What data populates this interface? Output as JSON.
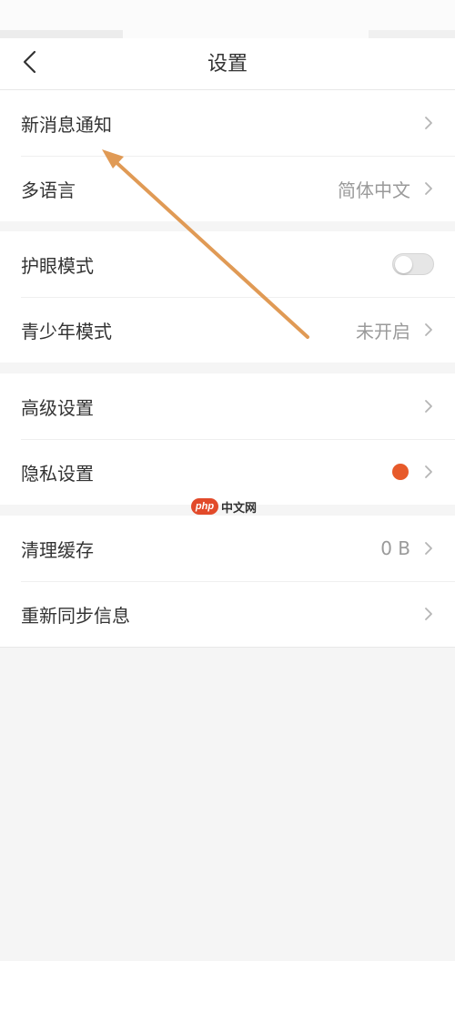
{
  "header": {
    "title": "设置",
    "back_icon": "chevron-left-icon"
  },
  "groups": [
    {
      "items": [
        {
          "label": "新消息通知",
          "value": ""
        },
        {
          "label": "多语言",
          "value": "简体中文"
        }
      ]
    },
    {
      "items": [
        {
          "label": "护眼模式",
          "toggle": false
        },
        {
          "label": "青少年模式",
          "value": "未开启"
        }
      ]
    },
    {
      "items": [
        {
          "label": "高级设置",
          "value": ""
        },
        {
          "label": "隐私设置",
          "badge_color": "#e75a2a"
        }
      ]
    },
    {
      "items": [
        {
          "label": "清理缓存",
          "value": "0 B"
        },
        {
          "label": "重新同步信息",
          "value": ""
        }
      ]
    }
  ],
  "watermark": {
    "brand": "php",
    "text": "中文网"
  },
  "annotation": {
    "color": "#e09a55"
  },
  "colors": {
    "accent_dot": "#e75a2a",
    "text": "#333333",
    "secondary_text": "#9a9a9a",
    "background": "#f5f5f5"
  }
}
